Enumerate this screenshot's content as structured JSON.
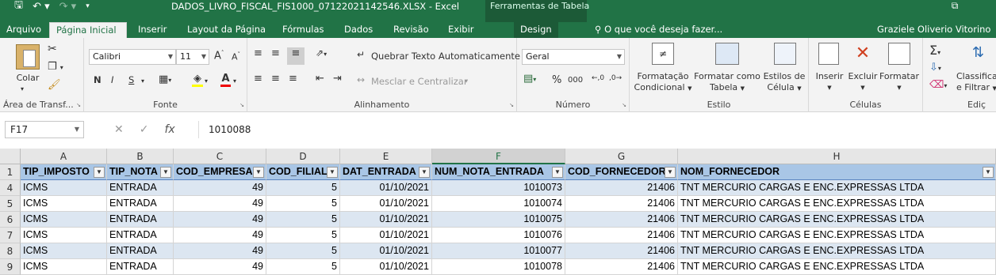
{
  "titlebar": {
    "title": "DADOS_LIVRO_FISCAL_FIS1000_07122021142546.XLSX - Excel",
    "tools_title": "Ferramentas de Tabela",
    "qat_icons": [
      "save-icon",
      "undo-icon",
      "redo-icon",
      "customize-icon"
    ]
  },
  "menu": {
    "tabs": [
      "Arquivo",
      "Página Inicial",
      "Inserir",
      "Layout da Página",
      "Fórmulas",
      "Dados",
      "Revisão",
      "Exibir",
      "Design"
    ],
    "active_tab": "Página Inicial",
    "tell_me": "O que você deseja fazer...",
    "user": "Graziele Oliverio Vitorino"
  },
  "ribbon": {
    "clipboard": {
      "paste": "Colar",
      "label": "Área de Transf..."
    },
    "font": {
      "name": "Calibri",
      "size": "11",
      "bold": "N",
      "italic": "I",
      "underline": "S",
      "label": "Fonte"
    },
    "alignment": {
      "wrap": "Quebrar Texto Automaticamente",
      "merge": "Mesclar e Centralizar",
      "label": "Alinhamento"
    },
    "number": {
      "format": "Geral",
      "percent": "%",
      "thousands": "000",
      "label": "Número"
    },
    "styles": {
      "cond_1": "Formatação",
      "cond_2": "Condicional",
      "table_1": "Formatar como",
      "table_2": "Tabela",
      "cell_1": "Estilos de",
      "cell_2": "Célula",
      "label": "Estilo"
    },
    "cells": {
      "insert": "Inserir",
      "delete": "Excluir",
      "format": "Formatar",
      "label": "Células"
    },
    "editing": {
      "sort_1": "Classifica",
      "sort_2": "e Filtrar",
      "label": "Ediç"
    }
  },
  "formula_bar": {
    "name_box": "F17",
    "fx": "fx",
    "value": "1010088"
  },
  "sheet": {
    "columns": [
      "A",
      "B",
      "C",
      "D",
      "E",
      "F",
      "G",
      "H"
    ],
    "selected_column": "F",
    "header_row_number": "1",
    "headers": [
      "TIP_IMPOSTO",
      "TIP_NOTA",
      "COD_EMPRESA",
      "COD_FILIAL",
      "DAT_ENTRADA",
      "NUM_NOTA_ENTRADA",
      "COD_FORNECEDOR",
      "NOM_FORNECEDOR"
    ],
    "rows": [
      {
        "n": "4",
        "cells": [
          "ICMS",
          "ENTRADA",
          "49",
          "5",
          "01/10/2021",
          "1010073",
          "21406",
          "TNT MERCURIO CARGAS E ENC.EXPRESSAS LTDA"
        ]
      },
      {
        "n": "5",
        "cells": [
          "ICMS",
          "ENTRADA",
          "49",
          "5",
          "01/10/2021",
          "1010074",
          "21406",
          "TNT MERCURIO CARGAS E ENC.EXPRESSAS LTDA"
        ]
      },
      {
        "n": "6",
        "cells": [
          "ICMS",
          "ENTRADA",
          "49",
          "5",
          "01/10/2021",
          "1010075",
          "21406",
          "TNT MERCURIO CARGAS E ENC.EXPRESSAS LTDA"
        ]
      },
      {
        "n": "7",
        "cells": [
          "ICMS",
          "ENTRADA",
          "49",
          "5",
          "01/10/2021",
          "1010076",
          "21406",
          "TNT MERCURIO CARGAS E ENC.EXPRESSAS LTDA"
        ]
      },
      {
        "n": "8",
        "cells": [
          "ICMS",
          "ENTRADA",
          "49",
          "5",
          "01/10/2021",
          "1010077",
          "21406",
          "TNT MERCURIO CARGAS E ENC.EXPRESSAS LTDA"
        ]
      },
      {
        "n": "9",
        "cells": [
          "ICMS",
          "ENTRADA",
          "49",
          "5",
          "01/10/2021",
          "1010078",
          "21406",
          "TNT MERCURIO CARGAS E ENC.EXPRESSAS LTDA"
        ]
      }
    ],
    "numeric_columns": [
      2,
      3,
      4,
      5,
      6
    ]
  },
  "colors": {
    "brand": "#217346",
    "header_fill": "#a9c6e6",
    "band_fill": "#dce6f1"
  }
}
